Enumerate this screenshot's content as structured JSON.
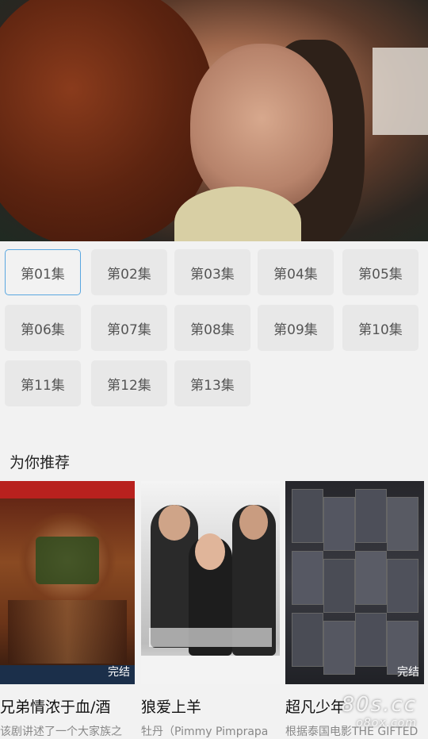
{
  "player": {
    "content": "video-frame"
  },
  "episodes": [
    "第01集",
    "第02集",
    "第03集",
    "第04集",
    "第05集",
    "第06集",
    "第07集",
    "第08集",
    "第09集",
    "第10集",
    "第11集",
    "第12集",
    "第13集"
  ],
  "active_episode": 0,
  "recommend": {
    "title": "为你推荐",
    "items": [
      {
        "title": "兄弟情浓于血/酒",
        "desc": "该剧讲述了一个大家族之",
        "badge": "完结"
      },
      {
        "title": "狼爱上羊",
        "desc": "牡丹（Pimmy Pimprapa",
        "badge": ""
      },
      {
        "title": "超凡少年",
        "desc": "根据泰国电影THE GIFTED",
        "badge": "完结"
      }
    ]
  },
  "watermark": {
    "text": "80s.cc",
    "sub": "o8ox.com"
  },
  "colors": {
    "accent": "#5aa7e0",
    "background": "#f2f2f2",
    "tile": "#e8e8e8"
  }
}
